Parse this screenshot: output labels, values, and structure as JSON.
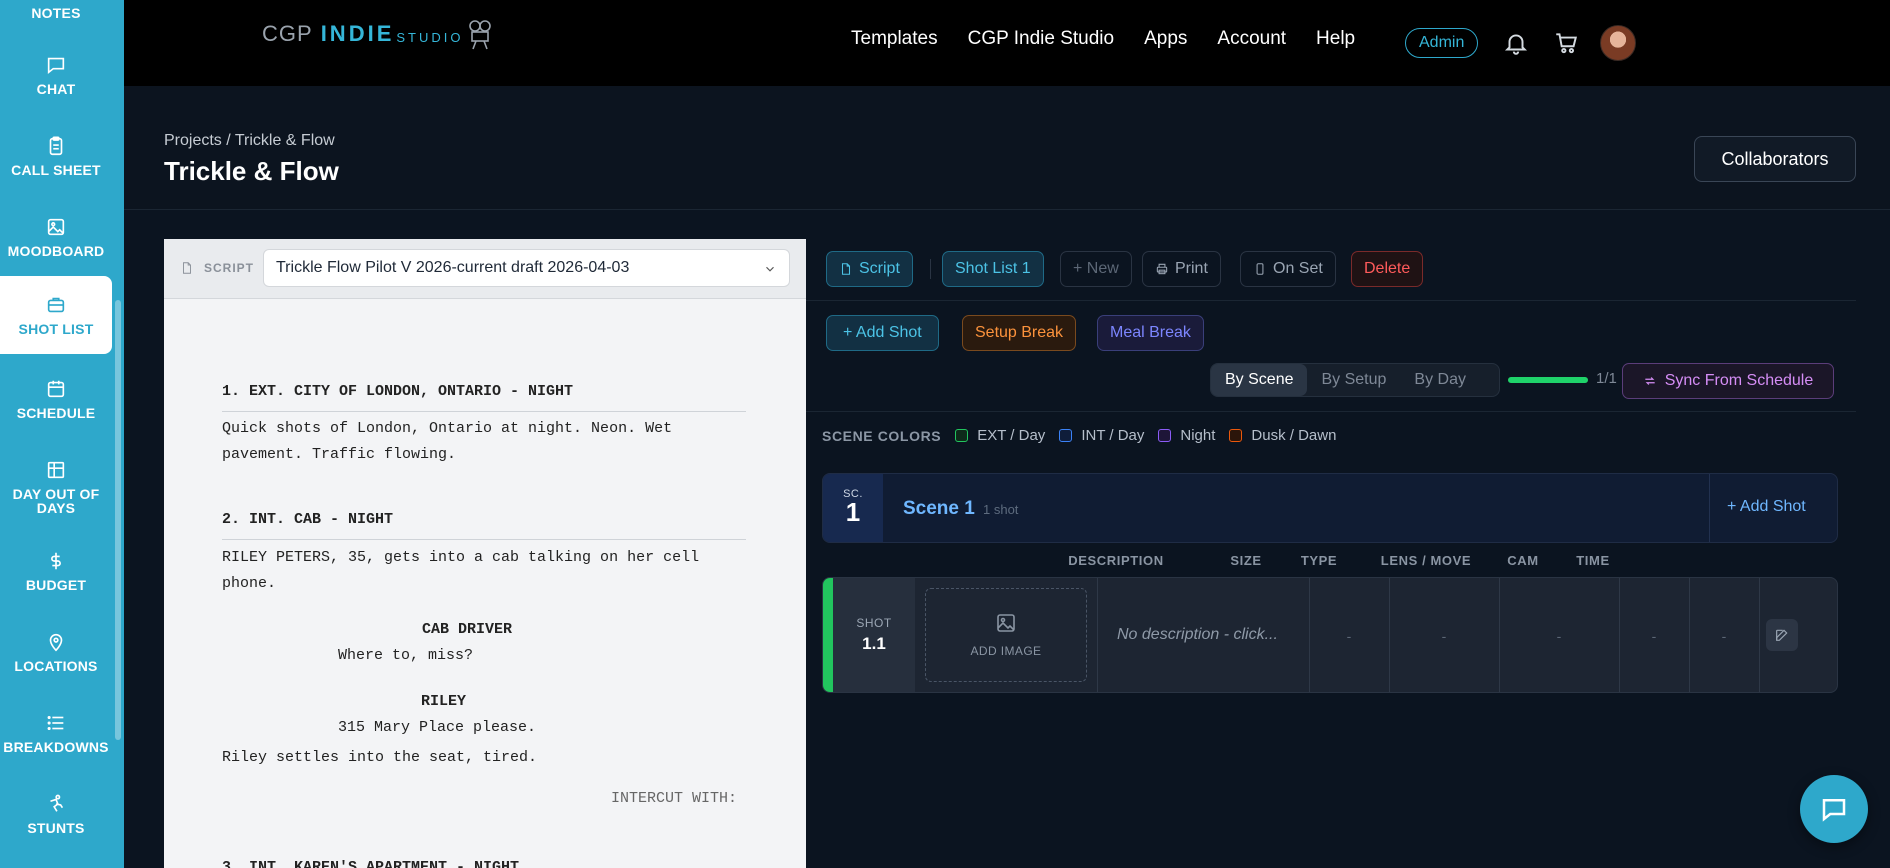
{
  "sidebar": {
    "items": [
      {
        "label": "NOTES",
        "icon": "notes-icon"
      },
      {
        "label": "CHAT",
        "icon": "chat-icon"
      },
      {
        "label": "CALL SHEET",
        "icon": "clipboard-icon"
      },
      {
        "label": "MOODBOARD",
        "icon": "image-icon"
      },
      {
        "label": "SHOT LIST",
        "icon": "briefcase-icon"
      },
      {
        "label": "SCHEDULE",
        "icon": "calendar-icon"
      },
      {
        "label": "DAY OUT OF DAYS",
        "icon": "table-icon"
      },
      {
        "label": "BUDGET",
        "icon": "dollar-icon"
      },
      {
        "label": "LOCATIONS",
        "icon": "map-pin-icon"
      },
      {
        "label": "BREAKDOWNS",
        "icon": "list-icon"
      },
      {
        "label": "STUNTS",
        "icon": "stunt-icon"
      }
    ],
    "active": "SHOT LIST",
    "accent": "#2ea8cb"
  },
  "topnav": {
    "logo": {
      "cgp": "CGP",
      "indie": "INDIE",
      "studio": "STUDIO"
    },
    "links": [
      "Templates",
      "CGP Indie Studio",
      "Apps",
      "Account",
      "Help"
    ],
    "admin_label": "Admin"
  },
  "header": {
    "breadcrumb": "Projects / Trickle & Flow",
    "title": "Trickle & Flow",
    "collaborators_label": "Collaborators"
  },
  "script": {
    "label": "SCRIPT",
    "selected_draft": "Trickle Flow Pilot V 2026-current draft 2026-04-03",
    "lines": {
      "s1_heading": "1. EXT. CITY OF LONDON, ONTARIO - NIGHT",
      "s1_action_a": "Quick shots of London, Ontario at night. Neon. Wet",
      "s1_action_b": "pavement. Traffic flowing.",
      "s2_heading": "2. INT. CAB - NIGHT",
      "s2_action_a": "RILEY PETERS, 35, gets into a cab talking on her cell",
      "s2_action_b": "phone.",
      "char1": "CAB DRIVER",
      "dial1": "Where to, miss?",
      "char2": "RILEY",
      "dial2": "315 Mary Place please.",
      "action3": "Riley settles into the seat, tired.",
      "transition": "INTERCUT WITH:",
      "s3_heading": "3. INT. KAREN'S APARTMENT - NIGHT"
    }
  },
  "toolbar": {
    "script": "Script",
    "shot_list": "Shot List 1",
    "new": "+ New",
    "print": "Print",
    "on_set": "On Set",
    "delete": "Delete",
    "add_shot": "+ Add Shot",
    "setup_break": "Setup Break",
    "meal_break": "Meal Break"
  },
  "view_toggle": {
    "options": [
      "By Scene",
      "By Setup",
      "By Day"
    ],
    "selected": "By Scene"
  },
  "progress": {
    "text": "1/1",
    "fraction": 1.0
  },
  "sync_label": "Sync From Schedule",
  "scene_colors": {
    "title": "SCENE COLORS",
    "items": [
      {
        "label": "EXT / Day",
        "color": "#22c55e"
      },
      {
        "label": "INT / Day",
        "color": "#3b82f6"
      },
      {
        "label": "Night",
        "color": "#8b5cf6"
      },
      {
        "label": "Dusk / Dawn",
        "color": "#ea580c"
      }
    ]
  },
  "scene": {
    "badge_label": "SC.",
    "number": "1",
    "name": "Scene 1",
    "count": "1 shot",
    "add_shot": "+ Add Shot"
  },
  "columns": [
    "DESCRIPTION",
    "SIZE",
    "TYPE",
    "LENS / MOVE",
    "CAM",
    "TIME"
  ],
  "shot": {
    "label": "SHOT",
    "number": "1.1",
    "add_image": "ADD IMAGE",
    "description": "No description - click...",
    "size": "-",
    "type": "-",
    "lens": "-",
    "cam": "-",
    "time": "-"
  }
}
